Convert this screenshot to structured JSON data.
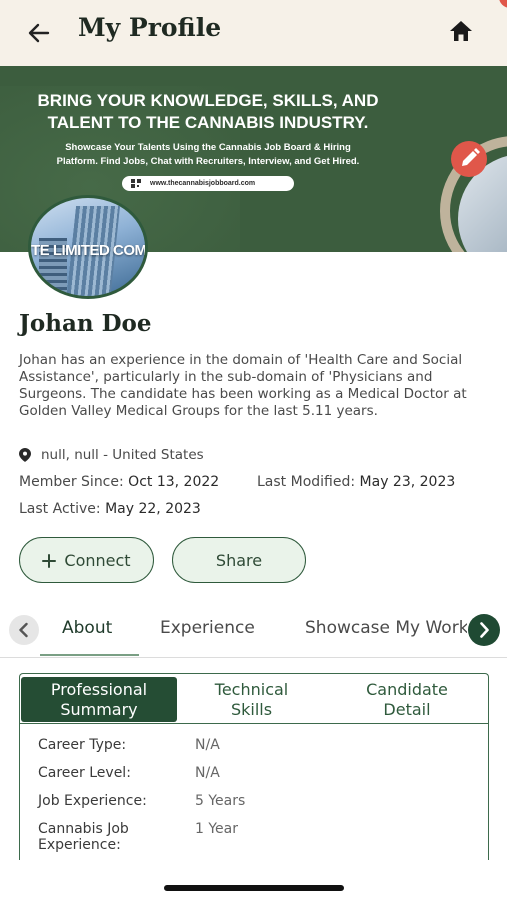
{
  "header": {
    "title": "My Profile"
  },
  "banner": {
    "headline_1": "BRING YOUR KNOWLEDGE, SKILLS, AND",
    "headline_2": "TALENT TO THE CANNABIS INDUSTRY.",
    "sub_1": "Showcase Your Talents Using the Cannabis Job Board & Hiring",
    "sub_2": "Platform. Find Jobs, Chat with Recruiters, Interview, and Get Hired.",
    "url": "www.thecannabisjobboard.com"
  },
  "avatar": {
    "text": "TE LIMITED COMPA"
  },
  "profile": {
    "name": "Johan Doe",
    "bio": "Johan has an experience in the domain of 'Health Care and Social Assistance', particularly in the sub-domain of 'Physicians and Surgeons. The candidate has been working as a Medical Doctor at Golden Valley Medical Groups for the last 5.11 years.",
    "location": "null, null - United States",
    "member_since_label": "Member Since:",
    "member_since": "Oct 13, 2022",
    "last_modified_label": "Last Modified:",
    "last_modified": "May 23, 2023",
    "last_active_label": "Last Active:",
    "last_active": "May 22, 2023"
  },
  "actions": {
    "connect": "Connect",
    "share": "Share"
  },
  "tabs": [
    "About",
    "Experience",
    "Showcase My Work"
  ],
  "subtabs": {
    "professional_1": "Professional",
    "professional_2": "Summary",
    "technical_1": "Technical",
    "technical_2": "Skills",
    "candidate_1": "Candidate",
    "candidate_2": "Detail"
  },
  "details": [
    {
      "label": "Career Type:",
      "value": "N/A"
    },
    {
      "label": "Career Level:",
      "value": "N/A"
    },
    {
      "label": "Job Experience:",
      "value": "5 Years"
    },
    {
      "label_1": "Cannabis Job",
      "label_2": "Experience:",
      "value": "1 Year"
    }
  ],
  "colors": {
    "header_bg": "#f6f1e8",
    "banner_green": "#3c5d3e",
    "accent_green": "#254d34",
    "edit_red": "#e0574a"
  }
}
